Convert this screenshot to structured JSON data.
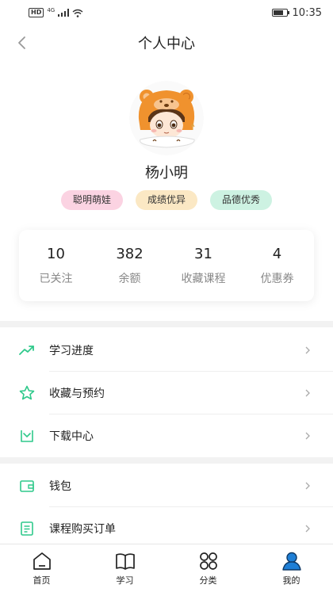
{
  "status_bar": {
    "hd": "HD",
    "net": "4G",
    "time": "10:35",
    "battery_level": 0.8
  },
  "nav": {
    "title": "个人中心",
    "back_icon": "chevron-left-icon"
  },
  "profile": {
    "name": "杨小明",
    "avatar_icon": "bear-hood-avatar",
    "tags": [
      {
        "label": "聪明萌娃",
        "color": "#fbd3e2"
      },
      {
        "label": "成绩优异",
        "color": "#fbe8c4"
      },
      {
        "label": "品德优秀",
        "color": "#cdf2e2"
      }
    ]
  },
  "stats": [
    {
      "value": "10",
      "label": "已关注"
    },
    {
      "value": "382",
      "label": "余额"
    },
    {
      "value": "31",
      "label": "收藏课程"
    },
    {
      "value": "4",
      "label": "优惠券"
    }
  ],
  "menu_group_1": [
    {
      "label": "学习进度",
      "icon": "trend-up-icon"
    },
    {
      "label": "收藏与预约",
      "icon": "star-icon"
    },
    {
      "label": "下载中心",
      "icon": "download-box-icon"
    }
  ],
  "menu_group_2": [
    {
      "label": "钱包",
      "icon": "wallet-icon"
    },
    {
      "label": "课程购买订单",
      "icon": "order-list-icon"
    }
  ],
  "tabs": [
    {
      "label": "首页",
      "icon": "home-icon"
    },
    {
      "label": "学习",
      "icon": "book-icon"
    },
    {
      "label": "分类",
      "icon": "grid-icon"
    },
    {
      "label": "我的",
      "icon": "user-icon",
      "active": true
    }
  ],
  "colors": {
    "accent": "#2fc98b",
    "active_tab": "#1f7fd6"
  }
}
